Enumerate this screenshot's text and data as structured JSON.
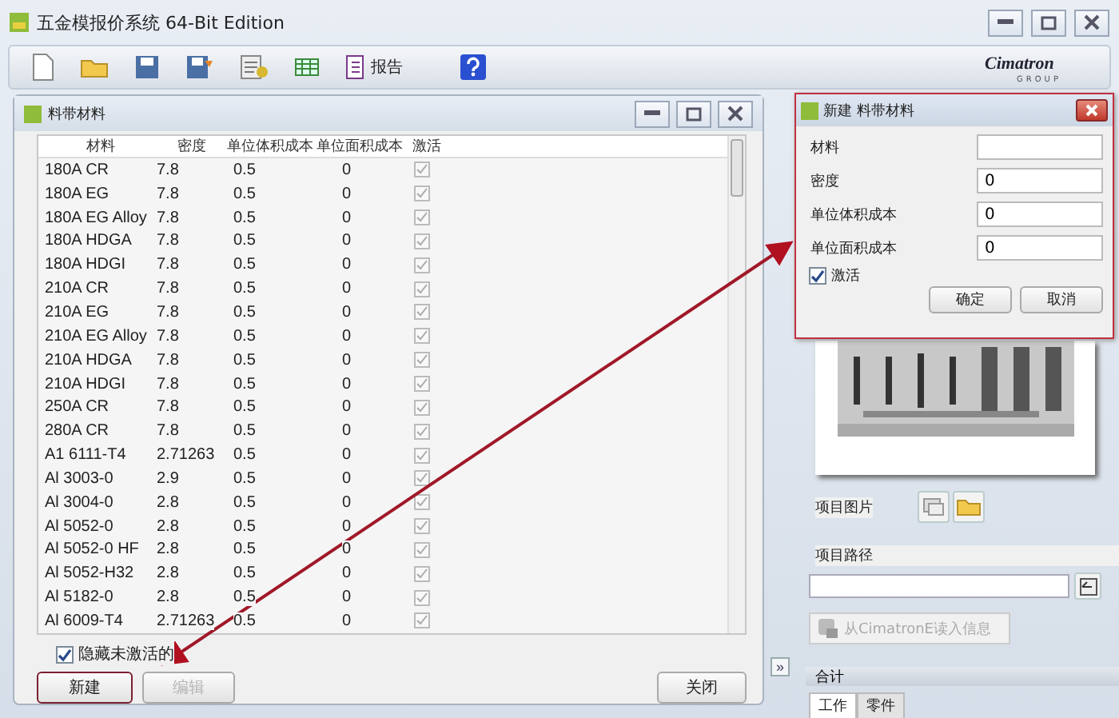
{
  "window": {
    "title": "五金模报价系统 64-Bit Edition"
  },
  "toolbar": {
    "report_button": {
      "label": "报告"
    }
  },
  "brand": {
    "name": "Cimatron",
    "sub": "GROUP"
  },
  "materials_window": {
    "title": "料带材料",
    "columns": [
      "材料",
      "密度",
      "单位体积成本",
      "单位面积成本",
      "激活"
    ],
    "rows": [
      {
        "material": "180A CR",
        "density": "7.8",
        "volume_cost": "0.5",
        "area_cost": "0",
        "active": true
      },
      {
        "material": "180A EG",
        "density": "7.8",
        "volume_cost": "0.5",
        "area_cost": "0",
        "active": true
      },
      {
        "material": "180A EG Alloy",
        "density": "7.8",
        "volume_cost": "0.5",
        "area_cost": "0",
        "active": true
      },
      {
        "material": "180A HDGA",
        "density": "7.8",
        "volume_cost": "0.5",
        "area_cost": "0",
        "active": true
      },
      {
        "material": "180A HDGI",
        "density": "7.8",
        "volume_cost": "0.5",
        "area_cost": "0",
        "active": true
      },
      {
        "material": "210A CR",
        "density": "7.8",
        "volume_cost": "0.5",
        "area_cost": "0",
        "active": true
      },
      {
        "material": "210A EG",
        "density": "7.8",
        "volume_cost": "0.5",
        "area_cost": "0",
        "active": true
      },
      {
        "material": "210A EG Alloy",
        "density": "7.8",
        "volume_cost": "0.5",
        "area_cost": "0",
        "active": true
      },
      {
        "material": "210A HDGA",
        "density": "7.8",
        "volume_cost": "0.5",
        "area_cost": "0",
        "active": true
      },
      {
        "material": "210A HDGI",
        "density": "7.8",
        "volume_cost": "0.5",
        "area_cost": "0",
        "active": true
      },
      {
        "material": "250A CR",
        "density": "7.8",
        "volume_cost": "0.5",
        "area_cost": "0",
        "active": true
      },
      {
        "material": "280A CR",
        "density": "7.8",
        "volume_cost": "0.5",
        "area_cost": "0",
        "active": true
      },
      {
        "material": "A1 6111-T4",
        "density": "2.71263",
        "volume_cost": "0.5",
        "area_cost": "0",
        "active": true
      },
      {
        "material": "Al 3003-0",
        "density": "2.9",
        "volume_cost": "0.5",
        "area_cost": "0",
        "active": true
      },
      {
        "material": "Al 3004-0",
        "density": "2.8",
        "volume_cost": "0.5",
        "area_cost": "0",
        "active": true
      },
      {
        "material": "Al 5052-0",
        "density": "2.8",
        "volume_cost": "0.5",
        "area_cost": "0",
        "active": true
      },
      {
        "material": "Al 5052-0 HF",
        "density": "2.8",
        "volume_cost": "0.5",
        "area_cost": "0",
        "active": true
      },
      {
        "material": "Al 5052-H32",
        "density": "2.8",
        "volume_cost": "0.5",
        "area_cost": "0",
        "active": true
      },
      {
        "material": "Al 5182-0",
        "density": "2.8",
        "volume_cost": "0.5",
        "area_cost": "0",
        "active": true
      },
      {
        "material": "Al 6009-T4",
        "density": "2.71263",
        "volume_cost": "0.5",
        "area_cost": "0",
        "active": true
      }
    ],
    "hide_inactive": {
      "label": "隐藏未激活的",
      "checked": true
    },
    "buttons": [
      {
        "label": "新建",
        "disabled": false,
        "highlighted": true
      },
      {
        "label": "编辑",
        "disabled": true,
        "highlighted": false
      }
    ],
    "close_button": {
      "label": "关闭"
    }
  },
  "new_material_dialog": {
    "title": "新建 料带材料",
    "fields": [
      {
        "label": "材料"
      },
      {
        "label": "密度",
        "value": "0"
      },
      {
        "label": "单位体积成本",
        "value": "0"
      },
      {
        "label": "单位面积成本",
        "value": "0"
      }
    ],
    "active": {
      "label": "激活",
      "checked": true
    },
    "buttons": [
      "确定",
      "取消"
    ]
  },
  "project_panel": {
    "image_label": "项目图片",
    "path_label": "项目路径",
    "import_button": {
      "label": "从CimatronE读入信息",
      "disabled": true
    },
    "expand_button": "»",
    "totals_header": "合计",
    "tabs": [
      {
        "label": "工作",
        "selected": true
      },
      {
        "label": "零件",
        "selected": false
      }
    ]
  }
}
